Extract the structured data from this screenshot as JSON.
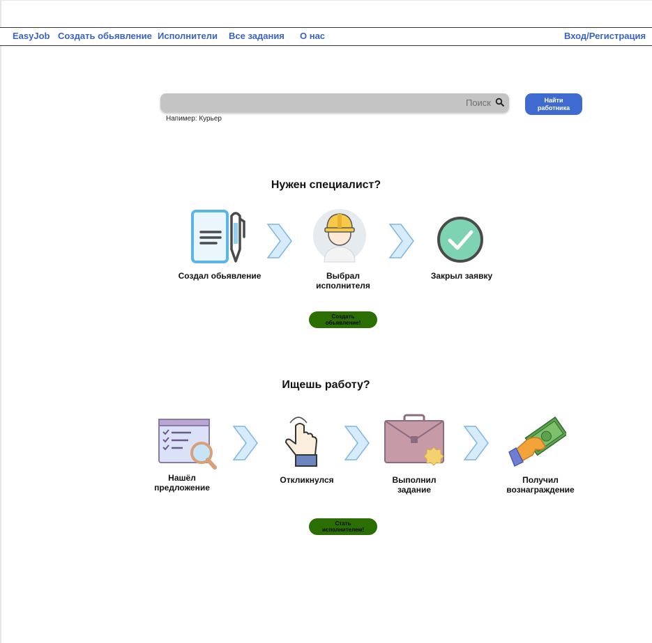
{
  "nav": {
    "brand": "EasyJob",
    "links": [
      "Создать обьявление",
      "Исполнители",
      "Все задания",
      "О нас"
    ],
    "login": "Вход/Регистрация"
  },
  "search": {
    "value": "",
    "label": "Поиск",
    "hint": "Напимер: Курьер",
    "button": "Найти работника"
  },
  "employer": {
    "title": "Нужен специалист?",
    "steps": [
      "Создал обьявление",
      "Выбрал исполнителя",
      "Закрыл заявку"
    ],
    "button": "Создать обьявление!"
  },
  "worker": {
    "title": "Ищешь работу?",
    "steps": [
      "Нашёл предложение",
      "Откликнулся",
      "Выполнил задание",
      "Получил вознаграждение"
    ],
    "button": "Стать исполнителем!"
  },
  "colors": {
    "link": "#3a63c4",
    "primary_button": "#3f6bd1",
    "green_button": "#2b6e04",
    "search_bg": "#c4c4c4"
  }
}
